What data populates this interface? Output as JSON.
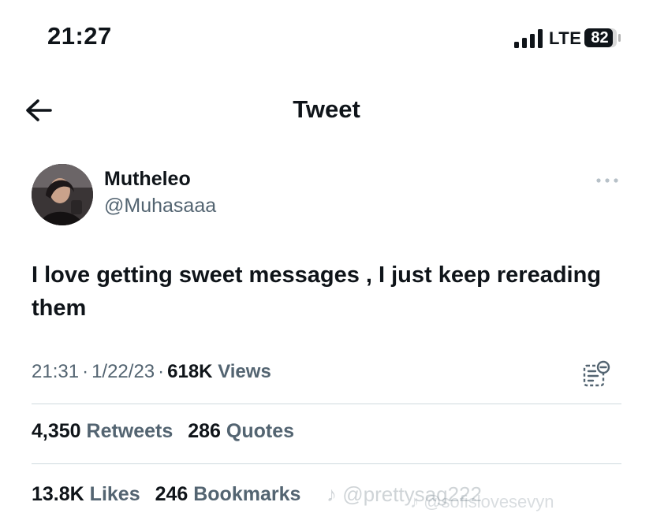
{
  "status_bar": {
    "time": "21:27",
    "network": "LTE",
    "battery": "82"
  },
  "header": {
    "title": "Tweet",
    "back_icon": "arrow-left-icon"
  },
  "author": {
    "display_name": "Mutheleo",
    "handle": "@Muhasaaa",
    "more_icon": "more-horizontal-icon"
  },
  "tweet": {
    "text": "I love getting sweet messages , I just keep rereading them"
  },
  "meta": {
    "time": "21:31",
    "separator": "·",
    "date": "1/22/23",
    "views_count": "618K",
    "views_label": "Views",
    "analytics_icon": "analytics-icon"
  },
  "stats": {
    "retweets_count": "4,350",
    "retweets_label": "Retweets",
    "quotes_count": "286",
    "quotes_label": "Quotes",
    "likes_count": "13.8K",
    "likes_label": "Likes",
    "bookmarks_count": "246",
    "bookmarks_label": "Bookmarks"
  },
  "watermark": {
    "text1": "@prettysag222",
    "text2": "@sofislovesevyn"
  },
  "colors": {
    "text": "#0f1419",
    "secondary": "#536471",
    "divider": "#cfd9de"
  }
}
